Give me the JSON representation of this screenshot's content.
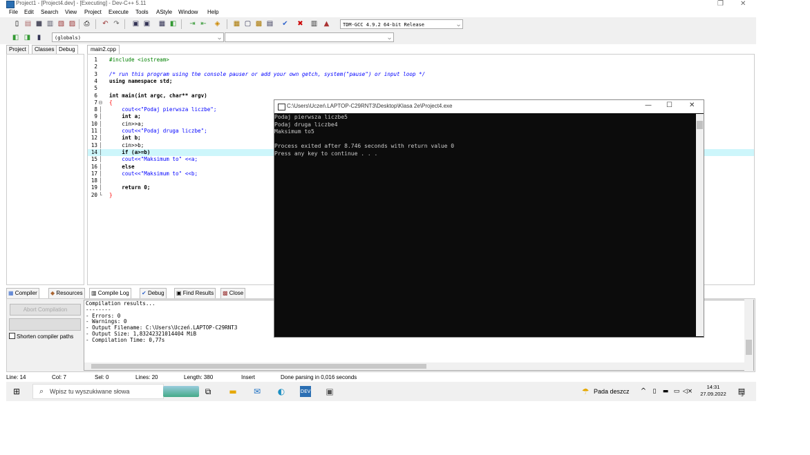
{
  "window": {
    "title": "Project1 - [Project4.dev] - [Executing] - Dev-C++ 5.11",
    "restore": "❐",
    "close": "✕"
  },
  "menu": [
    "File",
    "Edit",
    "Search",
    "View",
    "Project",
    "Execute",
    "Tools",
    "AStyle",
    "Window",
    "Help"
  ],
  "toolbar": {
    "compiler_select": "TDM-GCC 4.9.2 64-bit Release",
    "scope_select": "(globals)",
    "member_select": ""
  },
  "left_tabs": [
    "Project",
    "Classes",
    "Debug"
  ],
  "editor_tab": "main2.cpp",
  "code_lines": [
    {
      "n": "1",
      "text": "#include <iostream>"
    },
    {
      "n": "2",
      "text": ""
    },
    {
      "n": "3",
      "text": "/* run this program using the console pauser or add your own getch, system(\"pause\") or input loop */"
    },
    {
      "n": "4",
      "text": "using namespace std;"
    },
    {
      "n": "5",
      "text": ""
    },
    {
      "n": "6",
      "text": "int main(int argc, char** argv)"
    },
    {
      "n": "7",
      "text": "{"
    },
    {
      "n": "8",
      "text": "    cout<<\"Podaj pierwsza liczbe\";"
    },
    {
      "n": "9",
      "text": "    int a;"
    },
    {
      "n": "10",
      "text": "    cin>>a;"
    },
    {
      "n": "11",
      "text": "    cout<<\"Podaj druga liczbe\";"
    },
    {
      "n": "12",
      "text": "    int b;"
    },
    {
      "n": "13",
      "text": "    cin>>b;"
    },
    {
      "n": "14",
      "text": "    if (a>=b)"
    },
    {
      "n": "15",
      "text": "    cout<<\"Maksimum to\" <<a;"
    },
    {
      "n": "16",
      "text": "    else"
    },
    {
      "n": "17",
      "text": "    cout<<\"Maksimum to\" <<b;"
    },
    {
      "n": "18",
      "text": ""
    },
    {
      "n": "19",
      "text": "    return 0;"
    },
    {
      "n": "20",
      "text": "}"
    }
  ],
  "bottom_tabs": [
    "Compiler",
    "Resources",
    "Compile Log",
    "Debug",
    "Find Results",
    "Close"
  ],
  "abort_button": "Abort Compilation",
  "shorten_paths_label": "Shorten compiler paths",
  "compile_log": "Compilation results...\n--------\n- Errors: 0\n- Warnings: 0\n- Output Filename: C:\\Users\\Uczeń.LAPTOP-C29RNT3\n- Output Size: 1,83242321014404 MiB\n- Compilation Time: 0,77s",
  "status": {
    "line": "Line:  14",
    "col": "Col:   7",
    "sel": "Sel:   0",
    "lines": "Lines:   20",
    "length": "Length:  380",
    "mode": "Insert",
    "message": "Done parsing in 0,016 seconds"
  },
  "console": {
    "title": "C:\\Users\\Uczeń.LAPTOP-C29RNT3\\Desktop\\Klasa 2e\\Project4.exe",
    "output": "Podaj pierwsza liczbe5\nPodaj druga liczbe4\nMaksimum to5\n\nProcess exited after 8.746 seconds with return value 0\nPress any key to continue . . ."
  },
  "taskbar": {
    "search_placeholder": "Wpisz tu wyszukiwane słowa",
    "weather": "Pada deszcz",
    "time": "14:31",
    "date": "27.09.2022",
    "notification_count": "3"
  }
}
